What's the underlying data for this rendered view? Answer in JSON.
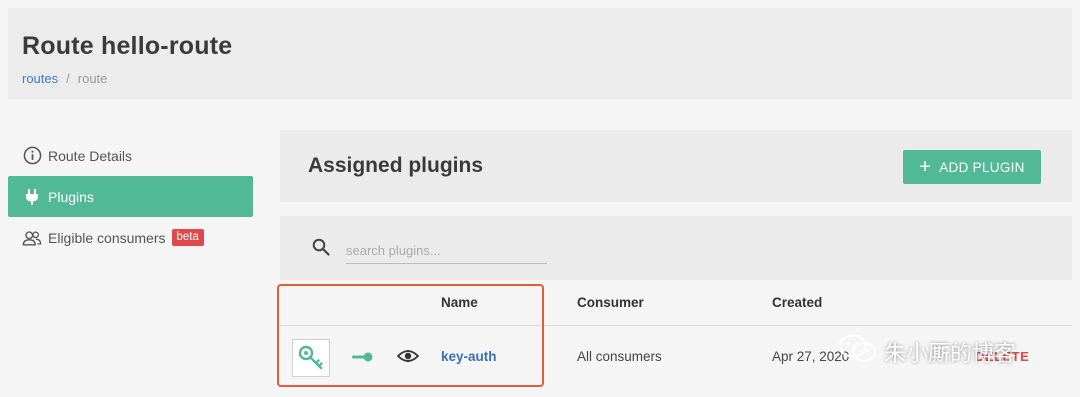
{
  "header": {
    "title": "Route hello-route",
    "breadcrumb": [
      {
        "label": "routes"
      },
      {
        "label": "/"
      },
      {
        "label": "route"
      }
    ]
  },
  "sidebar": {
    "items": [
      {
        "label": "Route Details",
        "icon": "info-icon"
      },
      {
        "label": "Plugins",
        "icon": "plug-icon"
      },
      {
        "label": "Eligible consumers",
        "icon": "users-icon",
        "badge": "beta"
      }
    ]
  },
  "plugins_panel": {
    "title": "Assigned plugins",
    "add_button_label": "ADD PLUGIN"
  },
  "search": {
    "placeholder": "search plugins..."
  },
  "table": {
    "columns": [
      "Name",
      "Consumer",
      "Created"
    ],
    "rows": [
      {
        "name": "key-auth",
        "consumer": "All consumers",
        "created": "Apr 27, 2020",
        "action": "DELETE",
        "enabled": true,
        "icon": "key-icon"
      }
    ]
  },
  "watermark": {
    "text": "朱小厮的博客",
    "icon": "wechat-icon"
  },
  "colors": {
    "accent": "#52b996",
    "danger": "#e0484b",
    "link": "#3b7fc4",
    "highlight": "#e35d3a"
  }
}
